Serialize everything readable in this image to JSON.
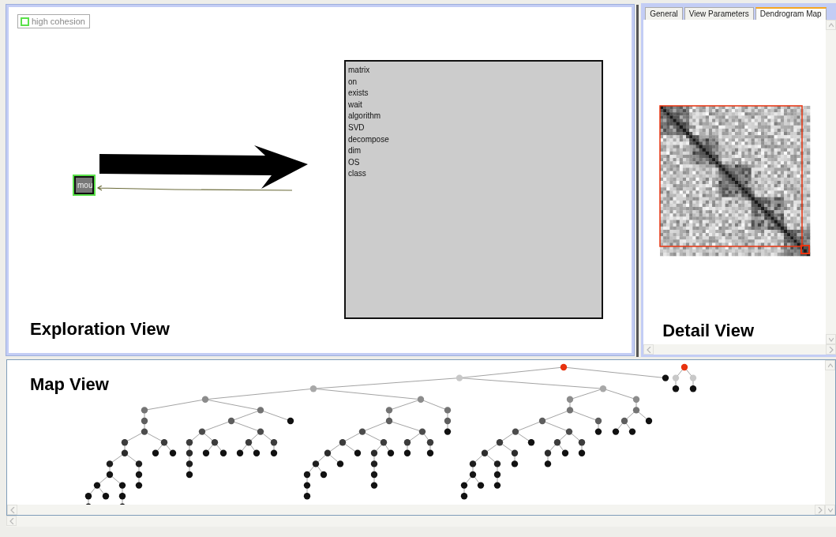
{
  "exploration_view": {
    "label": "Exploration View",
    "legend": {
      "label": "high cohesion"
    },
    "node": {
      "label": "mou",
      "highlighted": true
    },
    "term_box": {
      "terms": [
        "matrix",
        "on",
        "exists",
        "wait",
        "algorithm",
        "SVD",
        "decompose",
        "dim",
        "OS",
        "class"
      ]
    }
  },
  "detail_view": {
    "tabs": [
      {
        "label": "General",
        "selected": false
      },
      {
        "label": "View Parameters",
        "selected": false
      },
      {
        "label": "Dendrogram Map",
        "selected": true
      }
    ],
    "label": "Detail View"
  },
  "map_view": {
    "label": "Map View"
  }
}
